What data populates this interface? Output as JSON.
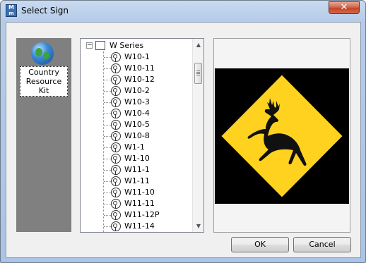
{
  "window": {
    "title": "Select Sign",
    "close_glyph": "✕",
    "app_icon_text_top": "M",
    "app_icon_text_bottom": "m"
  },
  "left_panel": {
    "kit_icon": "globe-icon",
    "kit_label": "Country Resource Kit"
  },
  "tree": {
    "root_expander": "−",
    "root_label": "W Series",
    "items": [
      "W10-1",
      "W10-11",
      "W10-12",
      "W10-2",
      "W10-3",
      "W10-4",
      "W10-5",
      "W10-8",
      "W1-1",
      "W1-10",
      "W11-1",
      "W1-11",
      "W11-10",
      "W11-11",
      "W11-12P",
      "W11-14"
    ]
  },
  "scrollbar": {
    "up_glyph": "▲",
    "down_glyph": "▼"
  },
  "preview": {
    "sign_name": "deer-crossing-sign",
    "sign_fill": "#ffd21f",
    "sign_border": "#000000",
    "background": "#000000"
  },
  "buttons": {
    "ok_label": "OK",
    "cancel_label": "Cancel"
  }
}
